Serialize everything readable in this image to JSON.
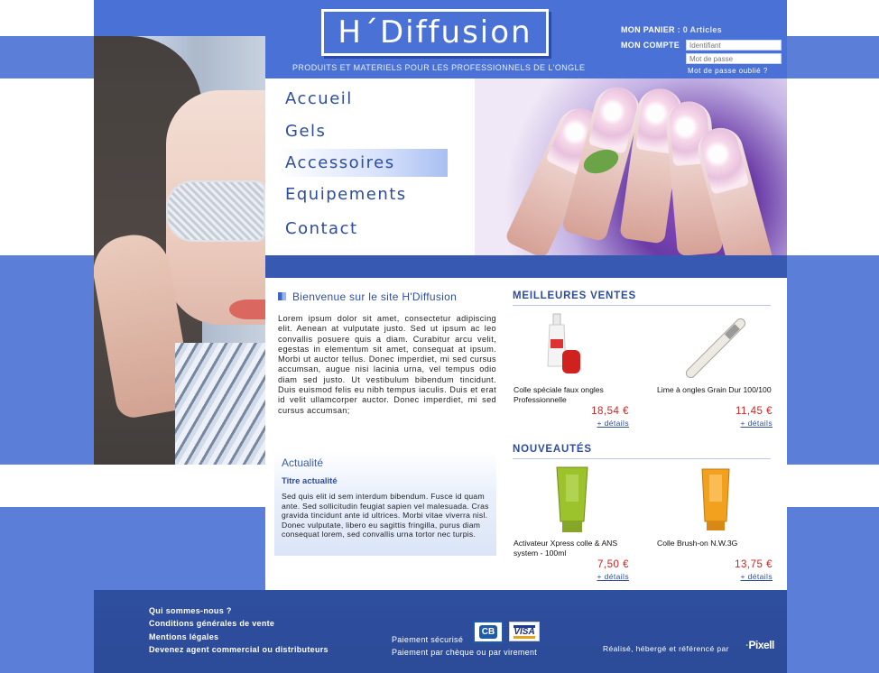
{
  "header": {
    "logo_text": "H´Diffusion",
    "tagline": "PRODUITS ET MATERIELS POUR LES PROFESSIONNELS DE L'ONGLE",
    "cart_label": "MON PANIER",
    "cart_value": ": 0 Articles",
    "account_label": "MON COMPTE",
    "login_id_placeholder": "Identifiant",
    "login_pw_placeholder": "Mot de passe",
    "forgot_password": "Mot de passe oublié ?"
  },
  "nav": {
    "items": [
      {
        "label": "Accueil"
      },
      {
        "label": "Gels"
      },
      {
        "label": "Accessoires"
      },
      {
        "label": "Equipements"
      },
      {
        "label": "Contact"
      }
    ],
    "active": "Accessoires"
  },
  "welcome": {
    "title": "Bienvenue sur le site H'Diffusion",
    "text": "Lorem ipsum dolor sit amet, consectetur adipiscing elit. Aenean at vulputate justo. Sed ut ipsum ac leo convallis posuere quis a diam. Curabitur arcu velit, egestas in elementum sit amet, consequat at ipsum. Morbi ut auctor tellus. Donec imperdiet, mi sed cursus accumsan, augue nisi lacinia urna, vel tempus odio diam sed justo. Ut vestibulum bibendum tincidunt. Duis euismod felis eu nibh tempus iaculis. Duis et erat id velit ullamcorper auctor. Donec imperdiet, mi sed cursus accumsan;"
  },
  "news": {
    "title": "Actualité",
    "subtitle": "Titre actualité",
    "text": "Sed quis elit id sem interdum bibendum. Fusce id quam ante. Sed sollicitudin feugiat sapien vel malesuada. Cras gravida tincidunt ante id ultrices. Morbi vitae viverra nisl. Donec vulputate, libero eu sagittis fringilla, purus diam consequat lorem, sed convallis urna tortor nec turpis."
  },
  "best_sellers": {
    "title": "MEILLEURES VENTES",
    "products": [
      {
        "name": "Colle spéciale faux ongles Professionnelle",
        "price": "18,54 €",
        "more": "+ détails"
      },
      {
        "name": "Lime à ongles Grain Dur 100/100",
        "price": "11,45 €",
        "more": "+ détails"
      }
    ]
  },
  "new_products": {
    "title": "NOUVEAUTÉS",
    "products": [
      {
        "name": "Activateur Xpress colle & ANS system - 100ml",
        "price": "7,50 €",
        "more": "+ détails"
      },
      {
        "name": "Colle Brush-on N.W.3G",
        "price": "13,75 €",
        "more": "+ détails"
      }
    ]
  },
  "footer": {
    "links": [
      {
        "label": "Qui sommes-nous ?"
      },
      {
        "label": "Conditions générales de vente"
      },
      {
        "label": "Mentions légales"
      },
      {
        "label": "Devenez agent commercial ou distributeurs"
      }
    ],
    "payment_secure": "Paiement sécurisé",
    "payment_other": "Paiement par chèque ou par virement",
    "cb_label": "CB",
    "visa_label": "VISA",
    "credit": "Réalisé, hébergé et référencé par",
    "credit_brand": "Pixell"
  },
  "colors": {
    "brand_blue": "#4a72d6",
    "dark_blue": "#2e4e9f",
    "price_red": "#d42020"
  }
}
